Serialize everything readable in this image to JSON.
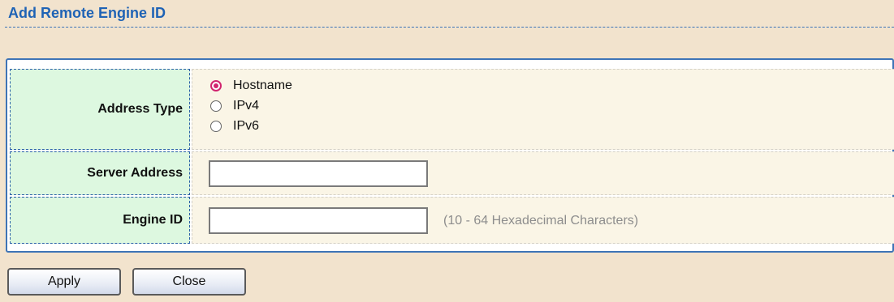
{
  "title": "Add Remote Engine ID",
  "form": {
    "address_type": {
      "label": "Address Type",
      "options": [
        "Hostname",
        "IPv4",
        "IPv6"
      ],
      "selected": "Hostname"
    },
    "server_address": {
      "label": "Server Address",
      "value": ""
    },
    "engine_id": {
      "label": "Engine ID",
      "value": "",
      "hint": "(10 - 64 Hexadecimal Characters)"
    }
  },
  "buttons": {
    "apply": "Apply",
    "close": "Close"
  },
  "colors": {
    "title": "#1f63b5",
    "radio_checked": "#d1246f",
    "label_background": "#ddf8e0",
    "value_background": "#faf5e6",
    "page_background": "#f2e3cd"
  }
}
